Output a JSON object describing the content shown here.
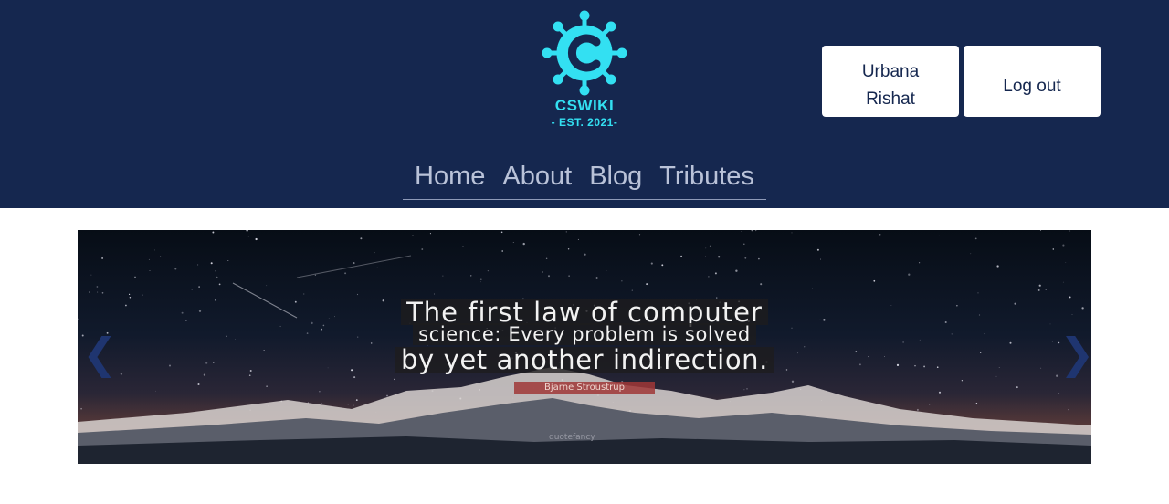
{
  "header": {
    "logo": {
      "name": "CSWIKI",
      "tagline": "- EST. 2021-",
      "icon": "virus-c-logo-icon",
      "color": "#33e0f2"
    },
    "user_name_line1": "Urbana",
    "user_name_line2": "Rishat",
    "logout_label": "Log out",
    "background_color": "#15274f"
  },
  "nav": {
    "items": [
      {
        "label": "Home"
      },
      {
        "label": "About"
      },
      {
        "label": "Blog"
      },
      {
        "label": "Tributes"
      }
    ]
  },
  "carousel": {
    "slide": {
      "quote_lines": [
        "The first law of computer",
        "science: Every problem is solved",
        "by yet another indirection."
      ],
      "author": "Bjarne Stroustrup",
      "watermark": "quotefancy"
    },
    "prev_icon": "chevron-left-icon",
    "next_icon": "chevron-right-icon",
    "prev_symbol": "❮",
    "next_symbol": "❯"
  }
}
